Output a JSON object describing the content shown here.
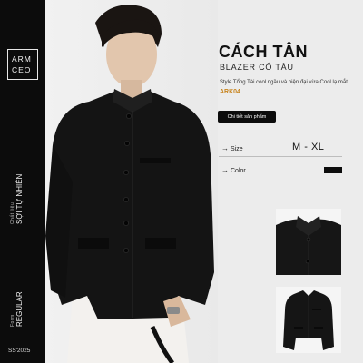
{
  "brand": {
    "line1": "ARM",
    "line2": "CEO"
  },
  "material": {
    "caption": "Chất liệu",
    "value": "SỢI TỰ NHIÊN"
  },
  "form": {
    "caption": "Form",
    "value": "REGULAR"
  },
  "season": "SS'2025",
  "product": {
    "title": "CÁCH TÂN",
    "subtitle": "BLAZER CỔ TÀU",
    "description": "Style Tổng Tài cool ngầu và hiện đại vừa Cool lạ mắt.",
    "code": "ARK04",
    "detail_button": "Chi tiết sản phẩm"
  },
  "specs": {
    "size_label": "Size",
    "size_value": "M - XL",
    "color_label": "Color",
    "color_hex": "#0d0d0d"
  },
  "icons": {
    "arrow": "arrow-right-icon"
  }
}
